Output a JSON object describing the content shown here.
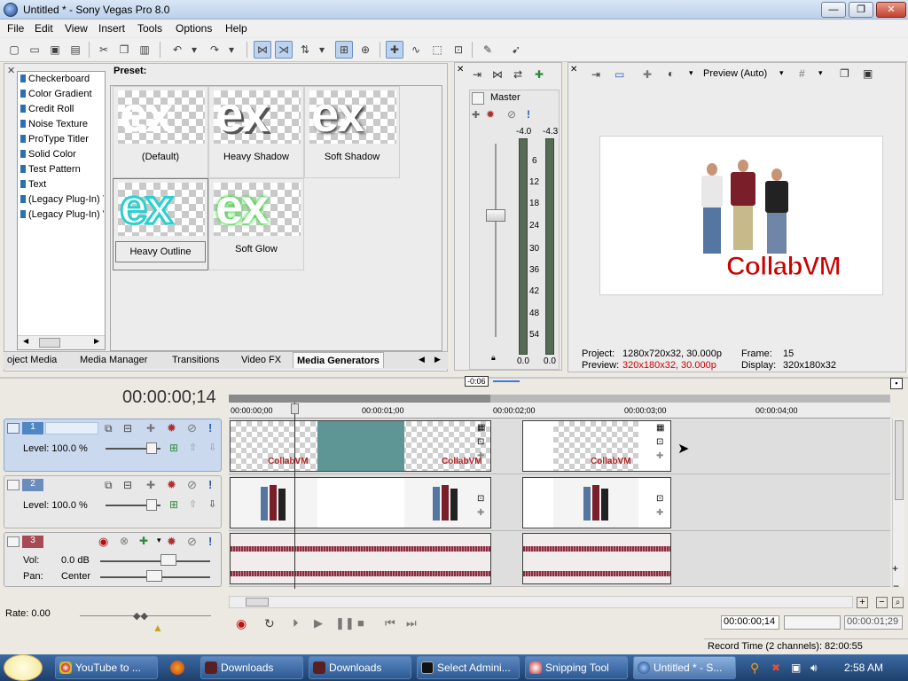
{
  "window": {
    "title": "Untitled * - Sony Vegas Pro 8.0",
    "min": "—",
    "max": "❐",
    "close": "✕"
  },
  "menu": [
    "File",
    "Edit",
    "View",
    "Insert",
    "Tools",
    "Options",
    "Help"
  ],
  "generators": {
    "preset_label": "Preset:",
    "list": [
      "Checkerboard",
      "Color Gradient",
      "Credit Roll",
      "Noise Texture",
      "ProType Titler",
      "Solid Color",
      "Test Pattern",
      "Text",
      "(Legacy Plug-In) T",
      "(Legacy Plug-In) V"
    ],
    "presets": [
      "(Default)",
      "Heavy Shadow",
      "Soft Shadow",
      "Heavy Outline",
      "Soft Glow"
    ],
    "thumb_text": "ex"
  },
  "tabs": [
    "oject Media",
    "Media Manager",
    "Transitions",
    "Video FX",
    "Media Generators"
  ],
  "mixer": {
    "master_label": "Master",
    "peak_left": "-4.0",
    "peak_right": "-4.3",
    "scale": [
      "6",
      "12",
      "18",
      "24",
      "30",
      "36",
      "42",
      "48",
      "54"
    ],
    "level_left": "0.0",
    "level_right": "0.0"
  },
  "preview": {
    "mode": "Preview (Auto)",
    "watermark": "CollabVM",
    "project_label": "Project:",
    "project_value": "1280x720x32, 30.000p",
    "preview_label": "Preview:",
    "preview_value": "320x180x32, 30.000p",
    "frame_label": "Frame:",
    "frame_value": "15",
    "display_label": "Display:",
    "display_value": "320x180x32",
    "accent_red": "#cc0000"
  },
  "timeline": {
    "timecode": "00:00:00;14",
    "loop_marker": "-0:06",
    "ruler": [
      "00:00:00;00",
      "00:00:01;00",
      "00:00:02;00",
      "00:00:03;00",
      "00:00:04;00"
    ],
    "tracks": [
      {
        "num": "1",
        "label1": "Level: 100.0 %"
      },
      {
        "num": "2",
        "label1": "Level: 100.0 %"
      },
      {
        "num": "3",
        "vol_label": "Vol:",
        "vol_value": "0.0 dB",
        "pan_label": "Pan:",
        "pan_value": "Center"
      }
    ],
    "clip_text": "CollabVM"
  },
  "transport": {
    "rate": "Rate: 0.00",
    "time_current": "00:00:00;14",
    "time_end": "00:00:01;29",
    "record_time": "Record Time (2 channels): 82:00:55"
  },
  "taskbar": {
    "items": [
      "YouTube to ...",
      "Downloads",
      "Downloads",
      "Select Admini...",
      "Snipping Tool",
      "Untitled * - S..."
    ],
    "clock": "2:58 AM"
  }
}
